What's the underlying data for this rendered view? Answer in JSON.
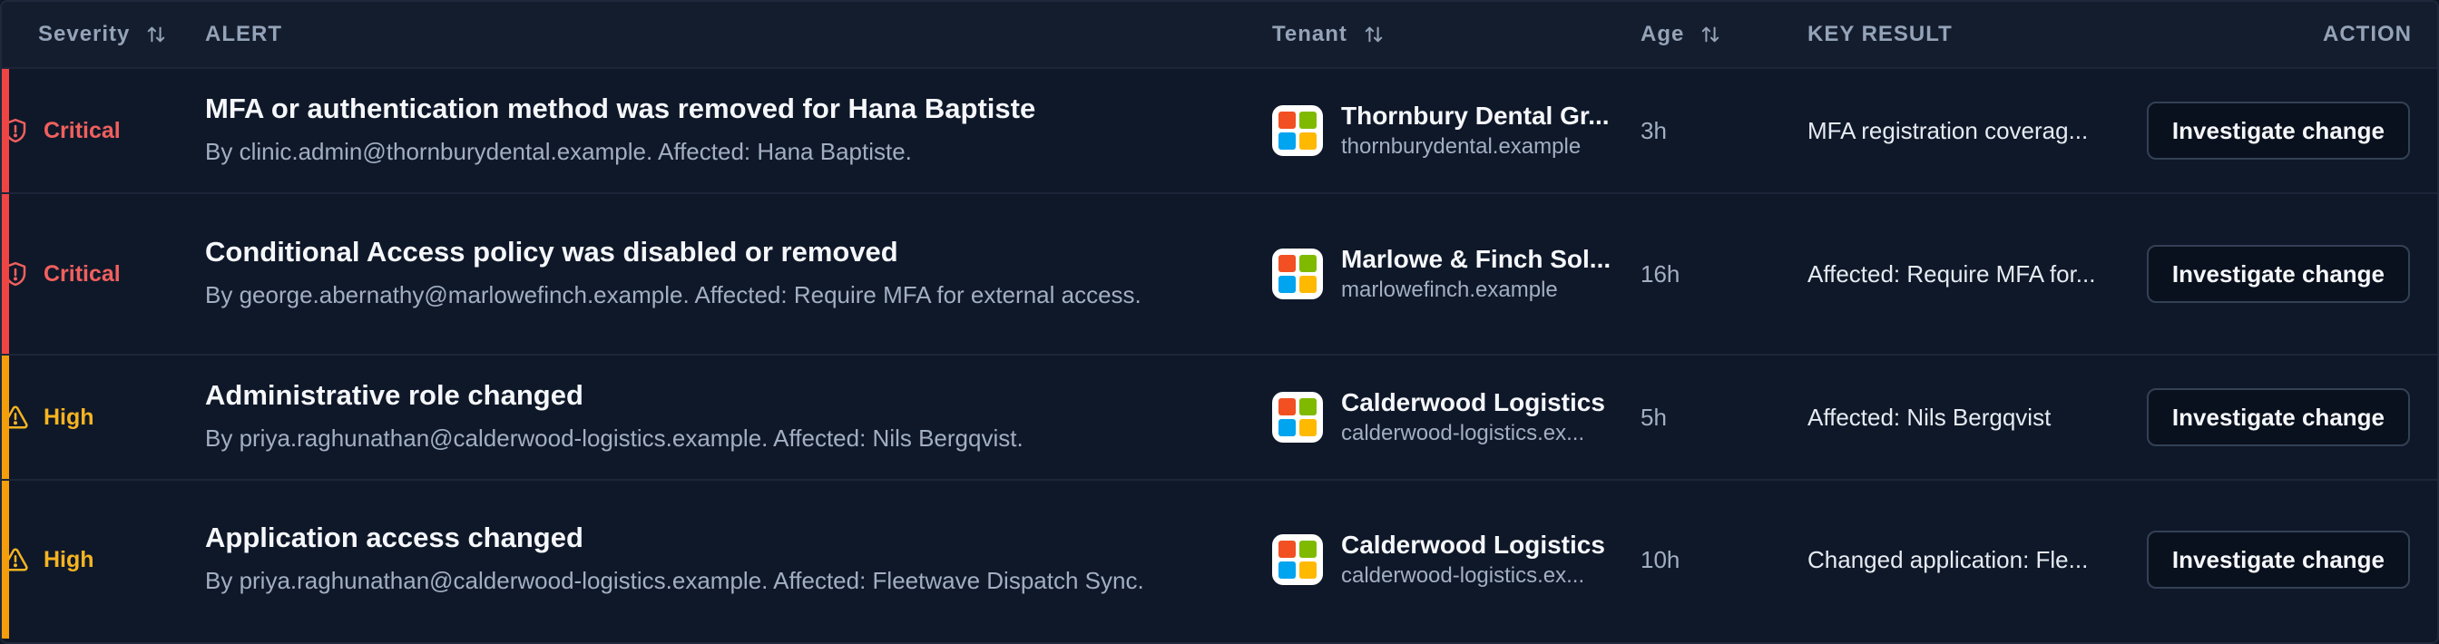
{
  "colors": {
    "critical": "#f0605e",
    "critical_bar": "#ee4444",
    "high": "#f5b421",
    "high_bar": "#f59e0b",
    "logo_tiles": [
      "#f25022",
      "#7fba00",
      "#00a4ef",
      "#ffb900"
    ]
  },
  "header": {
    "severity": "Severity",
    "alert": "ALERT",
    "tenant": "Tenant",
    "age": "Age",
    "key_result": "KEY RESULT",
    "action": "ACTION"
  },
  "rows": [
    {
      "severity": "Critical",
      "severity_icon": "shield-alert-icon",
      "title": "MFA or authentication method was removed for Hana Baptiste",
      "description": "By clinic.admin@thornburydental.example. Affected: Hana Baptiste.",
      "tenant_name": "Thornbury Dental Gr...",
      "tenant_domain": "thornburydental.example",
      "age": "3h",
      "key_result": "MFA registration coverag...",
      "action": "Investigate change"
    },
    {
      "severity": "Critical",
      "severity_icon": "shield-alert-icon",
      "title": "Conditional Access policy was disabled or removed",
      "description": "By george.abernathy@marlowefinch.example. Affected: Require MFA for external access.",
      "tenant_name": "Marlowe & Finch Sol...",
      "tenant_domain": "marlowefinch.example",
      "age": "16h",
      "key_result": "Affected: Require MFA for...",
      "action": "Investigate change"
    },
    {
      "severity": "High",
      "severity_icon": "warning-triangle-icon",
      "title": "Administrative role changed",
      "description": "By priya.raghunathan@calderwood-logistics.example. Affected: Nils Bergqvist.",
      "tenant_name": "Calderwood Logistics",
      "tenant_domain": "calderwood-logistics.ex...",
      "age": "5h",
      "key_result": "Affected: Nils Bergqvist",
      "action": "Investigate change"
    },
    {
      "severity": "High",
      "severity_icon": "warning-triangle-icon",
      "title": "Application access changed",
      "description": "By priya.raghunathan@calderwood-logistics.example. Affected: Fleetwave Dispatch Sync.",
      "tenant_name": "Calderwood Logistics",
      "tenant_domain": "calderwood-logistics.ex...",
      "age": "10h",
      "key_result": "Changed application: Fle...",
      "action": "Investigate change"
    }
  ]
}
